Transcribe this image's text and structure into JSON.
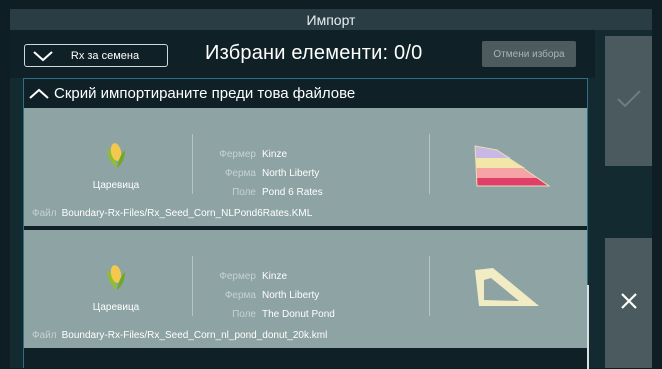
{
  "window": {
    "title": "Импорт"
  },
  "header": {
    "rx_dropdown_label": "Rx за семена",
    "selected_count": "Избрани елементи: 0/0",
    "cancel_selection_label": "Отмени избора"
  },
  "section": {
    "label": "Скрий импортираните преди това файлове"
  },
  "labels": {
    "farmer": "Фермер",
    "farm": "Ферма",
    "field": "Поле",
    "file": "Файл"
  },
  "items": [
    {
      "crop": "Царевица",
      "crop_icon": "corn-icon",
      "farmer": "Kinze",
      "farm": "North Liberty",
      "field": "Pond 6 Rates",
      "file": "Boundary-Rx-Files/Rx_Seed_Corn_NLPond6Rates.KML",
      "preview_icon": "field-rates-map-icon"
    },
    {
      "crop": "Царевица",
      "crop_icon": "corn-icon",
      "farmer": "Kinze",
      "farm": "North Liberty",
      "field": "The Donut Pond",
      "file": "Boundary-Rx-Files/Rx_Seed_Corn_nl_pond_donut_20k.kml",
      "preview_icon": "field-boundary-icon"
    }
  ],
  "side_buttons": {
    "confirm_icon": "check-icon",
    "close_icon": "close-icon"
  },
  "colors": {
    "card": "#8ea3a4",
    "button": "#4a5a5f",
    "accent_border": "#2c6f86"
  }
}
